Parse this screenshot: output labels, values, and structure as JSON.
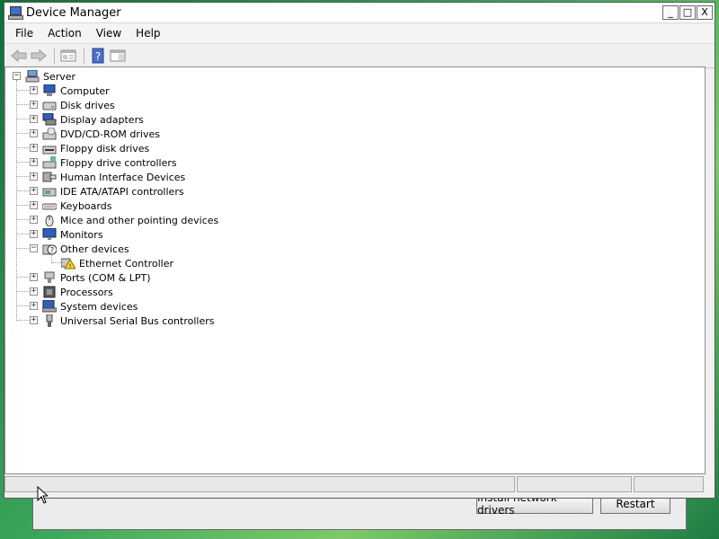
{
  "window": {
    "title": "Device Manager"
  },
  "titlebar_buttons": {
    "minimize": "_",
    "maximize": "□",
    "close": "X"
  },
  "menu": [
    "File",
    "Action",
    "View",
    "Help"
  ],
  "toolbar": [
    "back-icon",
    "forward-icon",
    "properties-icon",
    "help-icon",
    "show-hide-icon"
  ],
  "tree": {
    "root": "Server",
    "items": [
      {
        "label": "Computer",
        "icon": "computer-icon"
      },
      {
        "label": "Disk drives",
        "icon": "disk-drive-icon"
      },
      {
        "label": "Display adapters",
        "icon": "display-adapter-icon"
      },
      {
        "label": "DVD/CD-ROM drives",
        "icon": "dvd-drive-icon"
      },
      {
        "label": "Floppy disk drives",
        "icon": "floppy-drive-icon"
      },
      {
        "label": "Floppy drive controllers",
        "icon": "floppy-controller-icon"
      },
      {
        "label": "Human Interface Devices",
        "icon": "hid-icon"
      },
      {
        "label": "IDE ATA/ATAPI controllers",
        "icon": "ide-controller-icon"
      },
      {
        "label": "Keyboards",
        "icon": "keyboard-icon"
      },
      {
        "label": "Mice and other pointing devices",
        "icon": "mouse-icon"
      },
      {
        "label": "Monitors",
        "icon": "monitor-icon"
      },
      {
        "label": "Other devices",
        "icon": "unknown-device-icon",
        "expanded": true,
        "children": [
          {
            "label": "Ethernet Controller",
            "icon": "warning-device-icon"
          }
        ]
      },
      {
        "label": "Ports (COM & LPT)",
        "icon": "port-icon"
      },
      {
        "label": "Processors",
        "icon": "processor-icon"
      },
      {
        "label": "System devices",
        "icon": "system-device-icon"
      },
      {
        "label": "Universal Serial Bus controllers",
        "icon": "usb-icon"
      }
    ]
  },
  "background_dialog": {
    "install_button": "Install network drivers",
    "restart_button": "Restart"
  }
}
